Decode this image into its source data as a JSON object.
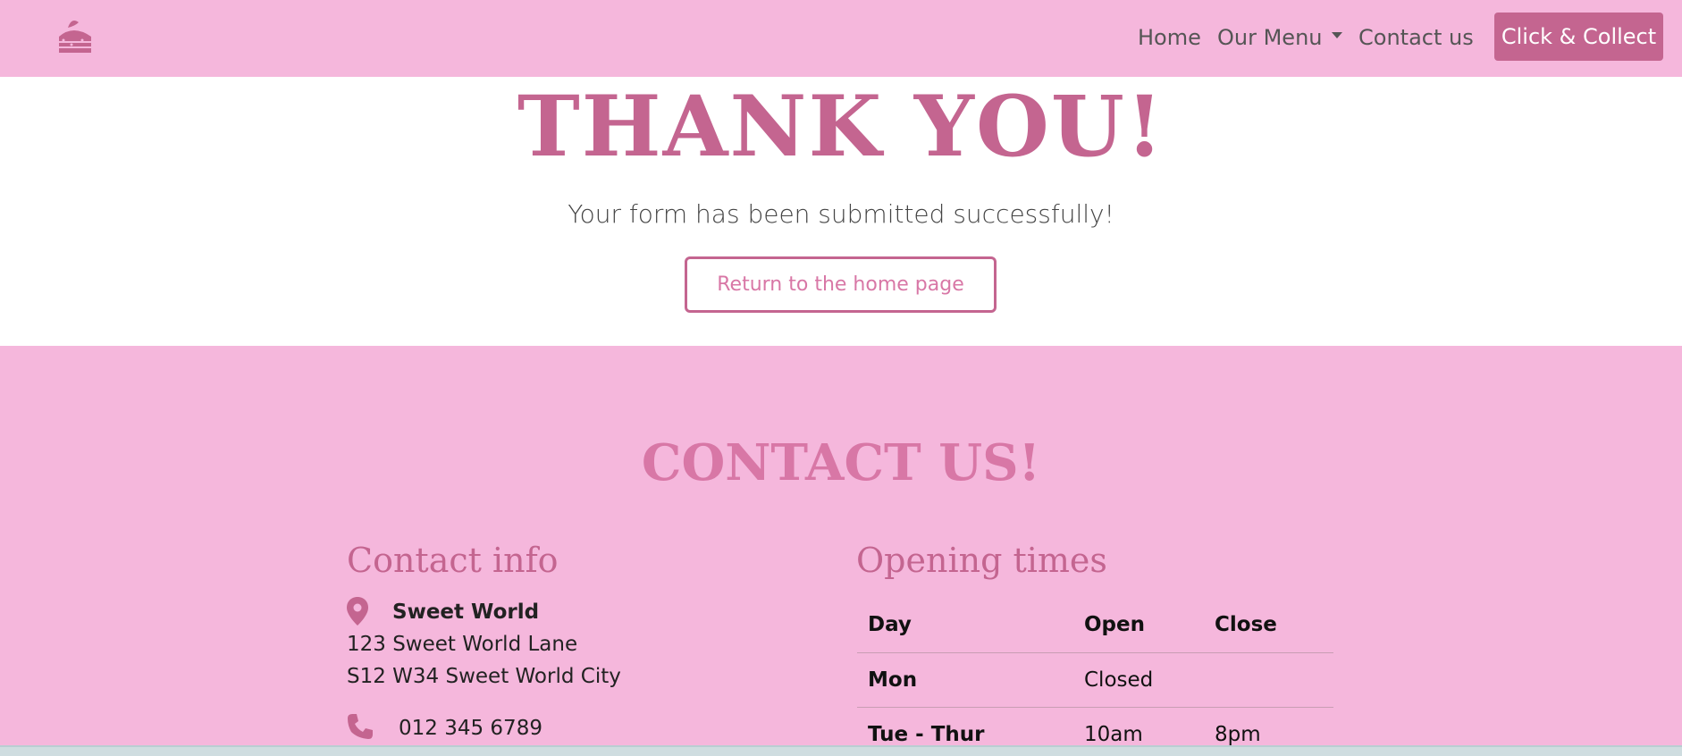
{
  "nav": {
    "logo_icon": "cake-slice-icon",
    "links": [
      "Home",
      "Our Menu",
      "Contact us"
    ],
    "cta_label": "Click & Collect"
  },
  "hero": {
    "title": "THANK YOU!",
    "subtitle": "Your form has been submitted successfully!",
    "button_label": "Return to the home page"
  },
  "footer": {
    "title": "CONTACT US!",
    "contact": {
      "heading": "Contact info",
      "name": "Sweet World",
      "address_line1": "123 Sweet World Lane",
      "address_line2": "S12 W34 Sweet World City",
      "phone": "012 345 6789"
    },
    "hours": {
      "heading": "Opening times",
      "columns": [
        "Day",
        "Open",
        "Close"
      ],
      "rows": [
        {
          "day": "Mon",
          "open": "Closed",
          "close": ""
        },
        {
          "day": "Tue - Thur",
          "open": "10am",
          "close": "8pm"
        }
      ]
    }
  },
  "colors": {
    "pink_bg": "#f5b7dc",
    "accent": "#c46590",
    "light_accent": "#d877a6"
  }
}
